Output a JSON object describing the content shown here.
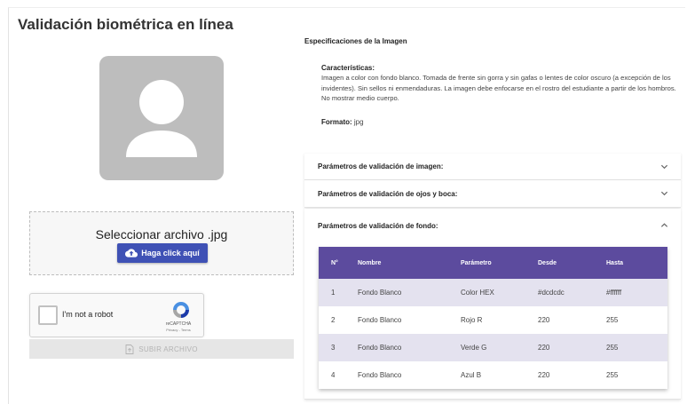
{
  "title": "Validación biométrica en línea",
  "upload": {
    "select_label": "Seleccionar archivo .jpg",
    "click_button": "Haga click aquí",
    "submit_button": "SUBIR ARCHIVO"
  },
  "recaptcha": {
    "label": "I'm not a robot",
    "brand": "reCAPTCHA",
    "links": "Privacy - Terms"
  },
  "specs": {
    "title": "Especificaciones de la Imagen",
    "characteristics_label": "Características:",
    "characteristics_text": "Imagen a color con fondo blanco. Tomada de frente sin gorra y sin gafas o lentes de color oscuro (a excepción de los invidentes). Sin sellos ni enmendaduras. La imagen debe enfocarse en el rostro del estudiante a partir de los hombros. No mostrar medio cuerpo.",
    "format_label": "Formato:",
    "format_value": "jpg"
  },
  "accordions": [
    {
      "label": "Parámetros de validación de imagen:",
      "expanded": false
    },
    {
      "label": "Parámetros de validación de ojos y boca:",
      "expanded": false
    },
    {
      "label": "Parámetros de validación de fondo:",
      "expanded": true
    }
  ],
  "table": {
    "headers": [
      "N°",
      "Nombre",
      "Parámetro",
      "Desde",
      "Hasta"
    ],
    "rows": [
      [
        "1",
        "Fondo Blanco",
        "Color HEX",
        "#dcdcdc",
        "#ffffff"
      ],
      [
        "2",
        "Fondo Blanco",
        "Rojo R",
        "220",
        "255"
      ],
      [
        "3",
        "Fondo Blanco",
        "Verde G",
        "220",
        "255"
      ],
      [
        "4",
        "Fondo Blanco",
        "Azul B",
        "220",
        "255"
      ]
    ]
  },
  "icons": {
    "avatar": "person-icon",
    "click_button": "cloud-upload-icon",
    "submit_button": "file-upload-icon",
    "collapsed": "chevron-down-icon",
    "expanded": "chevron-up-icon"
  },
  "colors": {
    "primary": "#3f51b5",
    "table_header": "#5c4b9e",
    "table_row_alt": "#e4e2ef",
    "avatar_bg": "#bdbdbd"
  }
}
